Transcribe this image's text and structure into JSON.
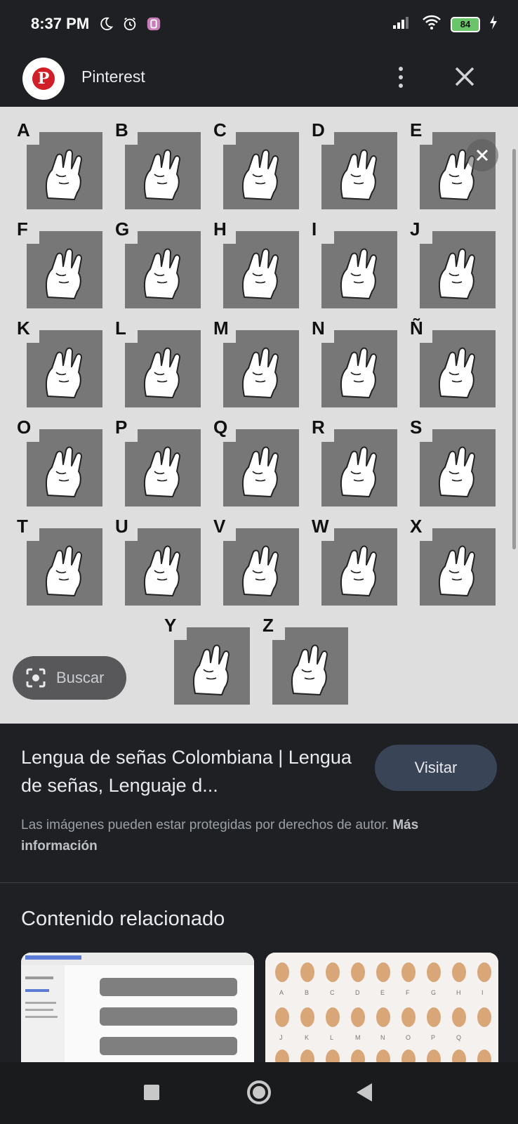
{
  "status_bar": {
    "time": "8:37 PM",
    "battery": "84"
  },
  "header": {
    "app_name": "Pinterest",
    "logo_letter": "P"
  },
  "image": {
    "letters": [
      "A",
      "B",
      "C",
      "D",
      "E",
      "F",
      "G",
      "H",
      "I",
      "J",
      "K",
      "L",
      "M",
      "N",
      "Ñ",
      "O",
      "P",
      "Q",
      "R",
      "S",
      "T",
      "U",
      "V",
      "W",
      "X",
      "Y",
      "Z"
    ],
    "lens_button_label": "Buscar"
  },
  "result": {
    "title": "Lengua de señas Colombiana | Lengua de señas, Lenguaje d...",
    "visit_label": "Visitar",
    "copyright_text": "Las imágenes pueden estar protegidas por derechos de autor.",
    "more_info_label": "Más información"
  },
  "related": {
    "title": "Contenido relacionado"
  },
  "colors": {
    "background": "#1f2023",
    "visit_button": "#394457",
    "pinterest_red": "#d01f27"
  }
}
